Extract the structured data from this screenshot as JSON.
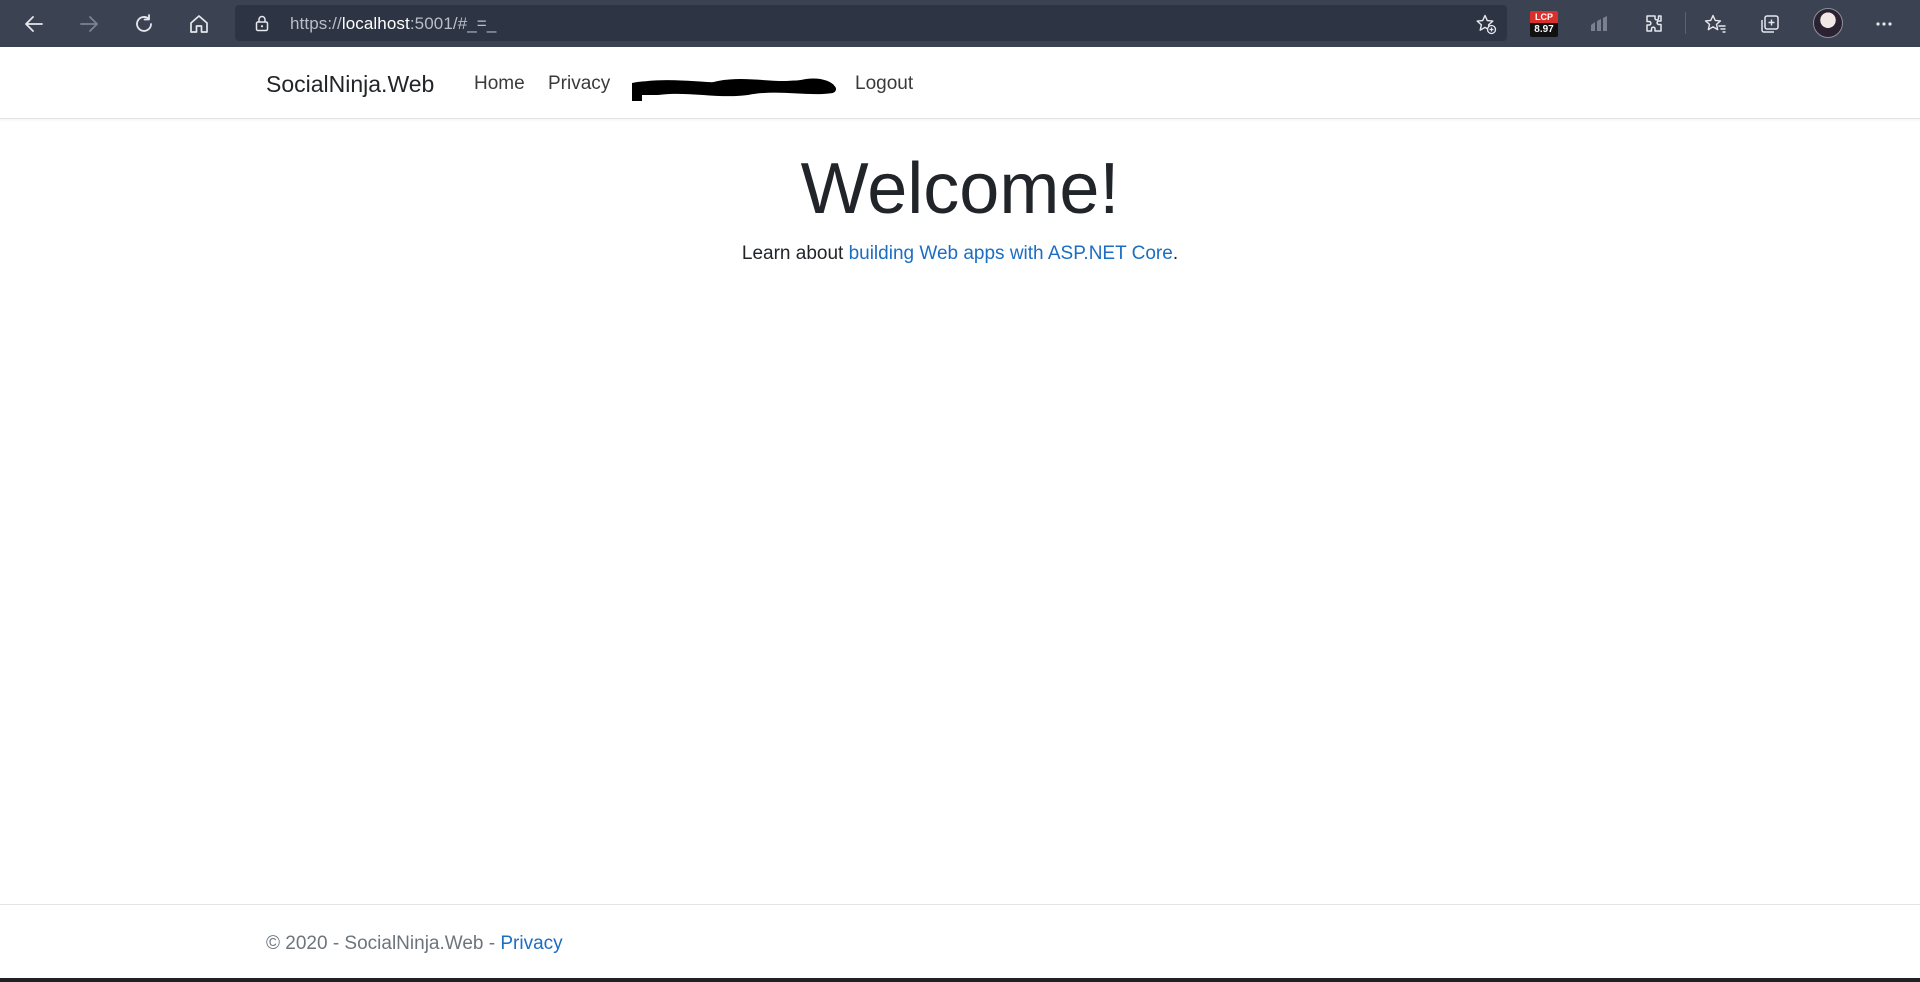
{
  "browser": {
    "url_prefix": "https://",
    "url_host": "localhost",
    "url_rest": ":5001/#_=_",
    "icons": [
      "back-icon",
      "forward-icon",
      "refresh-icon",
      "home-icon",
      "lock-icon",
      "add-favorite-icon",
      "lcp-extension-icon",
      "performance-extension-icon",
      "extensions-icon",
      "favorites-icon",
      "collections-icon",
      "profile-avatar",
      "more-icon"
    ],
    "lcp_label": "LCP",
    "lcp_value": "8.97",
    "toolbar_color": "#3b4252"
  },
  "navbar": {
    "brand": "SocialNinja.Web",
    "items": [
      {
        "label": "Home"
      },
      {
        "label": "Privacy"
      },
      {
        "label": "Logout"
      }
    ]
  },
  "main": {
    "heading": "Welcome!",
    "learn_prefix": "Learn about ",
    "learn_link": "building Web apps with ASP.NET Core",
    "learn_suffix": "."
  },
  "footer": {
    "copyright": "© 2020 - SocialNinja.Web - ",
    "privacy_link": "Privacy"
  },
  "colors": {
    "link": "#1b6ec2",
    "text": "#212529",
    "muted": "#6c757d"
  }
}
